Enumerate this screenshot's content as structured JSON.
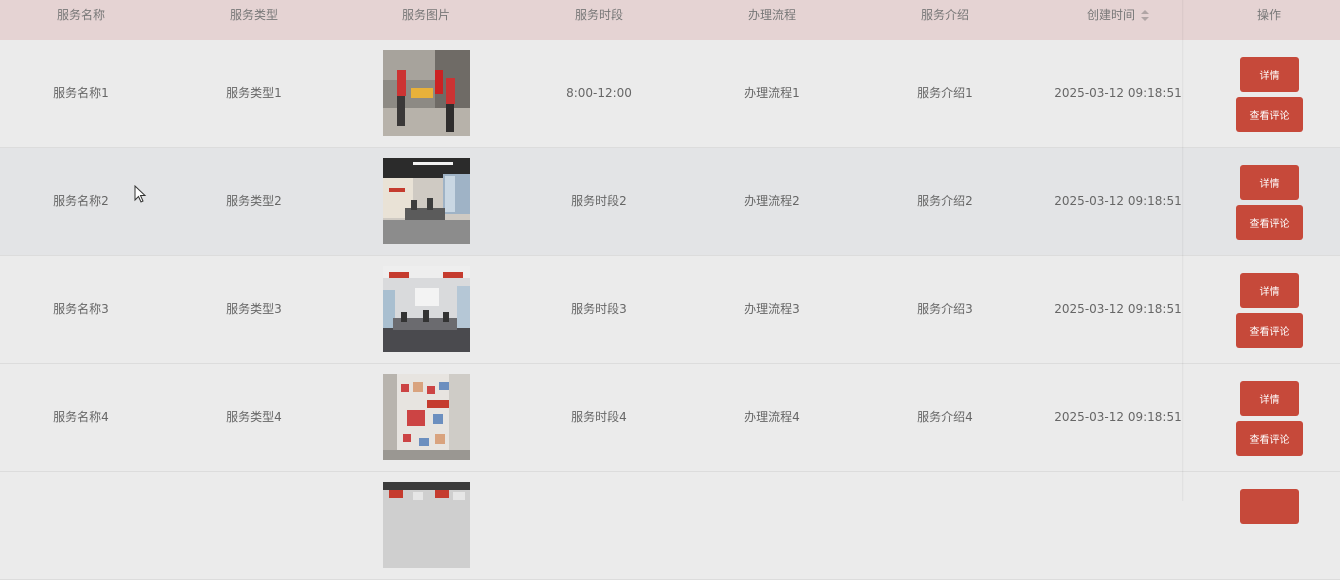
{
  "table": {
    "headers": {
      "name": "服务名称",
      "type": "服务类型",
      "image": "服务图片",
      "time": "服务时段",
      "process": "办理流程",
      "intro": "服务介绍",
      "created": "创建时间",
      "actions": "操作"
    },
    "rows": [
      {
        "name": "服务名称1",
        "type": "服务类型1",
        "time": "8:00-12:00",
        "process": "办理流程1",
        "intro": "服务介绍1",
        "created": "2025-03-12 09:18:51",
        "detail": "详情",
        "review": "查看评论"
      },
      {
        "name": "服务名称2",
        "type": "服务类型2",
        "time": "服务时段2",
        "process": "办理流程2",
        "intro": "服务介绍2",
        "created": "2025-03-12 09:18:51",
        "detail": "详情",
        "review": "查看评论"
      },
      {
        "name": "服务名称3",
        "type": "服务类型3",
        "time": "服务时段3",
        "process": "办理流程3",
        "intro": "服务介绍3",
        "created": "2025-03-12 09:18:51",
        "detail": "详情",
        "review": "查看评论"
      },
      {
        "name": "服务名称4",
        "type": "服务类型4",
        "time": "服务时段4",
        "process": "办理流程4",
        "intro": "服务介绍4",
        "created": "2025-03-12 09:18:51",
        "detail": "详情",
        "review": "查看评论"
      }
    ]
  },
  "colors": {
    "header_bg": "#e5d3d3",
    "button": "#c6493a",
    "row_alt": "#e3e4e6"
  },
  "icons": {
    "sort": "sort-caret-icon",
    "cursor": "mouse-pointer-icon"
  }
}
